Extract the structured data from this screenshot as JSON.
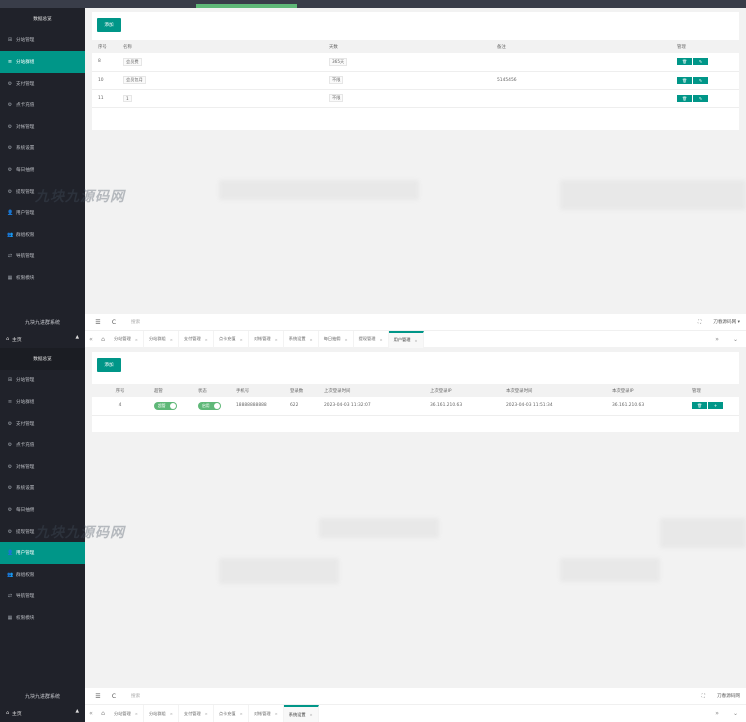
{
  "app_title": "九块九进群系统",
  "home_label": "主页",
  "watermark": "九块九源码网",
  "sidebar": {
    "header": "数据总览",
    "items": [
      {
        "label": "分站管理",
        "icon": "grid-icon"
      },
      {
        "label": "分站群组",
        "icon": "list-icon"
      },
      {
        "label": "支付管理",
        "icon": "gear-icon"
      },
      {
        "label": "点卡充值",
        "icon": "gear-icon"
      },
      {
        "label": "对帐管理",
        "icon": "gear-icon"
      },
      {
        "label": "系统设置",
        "icon": "gear-icon"
      },
      {
        "label": "每日抽佣",
        "icon": "gear-icon"
      },
      {
        "label": "提现管理",
        "icon": "gear-icon"
      },
      {
        "label": "用户管理",
        "icon": "user-icon"
      },
      {
        "label": "群组权限",
        "icon": "users-icon"
      },
      {
        "label": "导航管理",
        "icon": "nav-icon"
      },
      {
        "label": "权限模块",
        "icon": "module-icon"
      }
    ]
  },
  "panel1": {
    "add_label": "添加",
    "columns": [
      "序号",
      "名称",
      "天数",
      "备注",
      "管理"
    ],
    "rows": [
      {
        "id": "8",
        "name": "会员费",
        "days": "365天",
        "note": ""
      },
      {
        "id": "10",
        "name": "会员包月",
        "days": "不限",
        "note": "5145456"
      },
      {
        "id": "11",
        "name": "1",
        "days": "不限",
        "note": ""
      }
    ]
  },
  "panel2": {
    "add_label": "添加",
    "columns": [
      "序号",
      "超管",
      "状态",
      "手机号",
      "登录数",
      "上次登录时间",
      "上次登录IP",
      "本次登录时间",
      "本次登录IP",
      "管理"
    ],
    "rows": [
      {
        "id": "4",
        "admin": "超管",
        "status": "启用",
        "phone": "18888888888",
        "logins": "622",
        "last_time": "2023-04-03 11:32:07",
        "last_ip": "36.161.210.63",
        "this_time": "2023-04-03 11:51:34",
        "this_ip": "36.161.210.63"
      }
    ]
  },
  "header": {
    "search_placeholder": "搜索",
    "user": "刀春源码网"
  },
  "tabs1": [
    "分站管理",
    "分站群组",
    "支付管理",
    "点卡充值",
    "对帐管理",
    "系统设置",
    "每日抽佣",
    "提现管理",
    "用户管理"
  ],
  "tabs1_active": 8,
  "tabs2": [
    "分站管理",
    "分站群组",
    "支付管理",
    "点卡充值",
    "对帐管理",
    "系统设置"
  ],
  "tabs2_active": 5,
  "colors": {
    "accent": "#009688",
    "sidebar": "#20222a",
    "switch": "#5fb878"
  }
}
